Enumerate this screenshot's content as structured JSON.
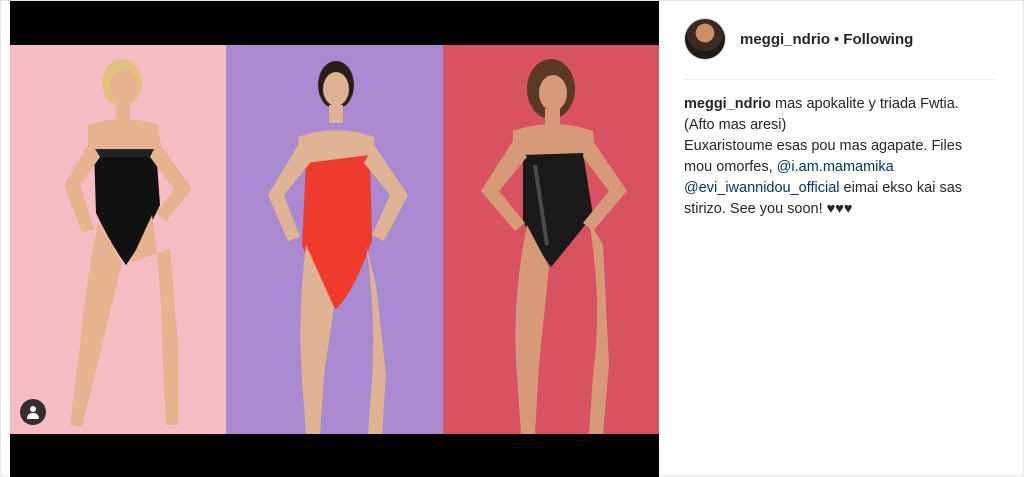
{
  "post": {
    "username": "meggi_ndrio",
    "separator": "•",
    "follow_status": "Following"
  },
  "caption": {
    "username": "meggi_ndrio",
    "line1": " mas apokalite y triada Fwtia.",
    "line2": "(Afto mas aresi)",
    "line3": "Euxaristoume esas pou mas agapate. Files mou omorfes, ",
    "mention1": "@i.am.mamamika",
    "mention2": "@evi_iwannidou_official",
    "line4": " eimai ekso kai sas stirizo. See you soon! ♥♥♥"
  },
  "media": {
    "panels": [
      {
        "background": "#f5bcc4",
        "swimsuit": "#111111",
        "hair": "#e2c27a"
      },
      {
        "background": "#a989cf",
        "swimsuit": "#ee3b2c",
        "hair": "#2a1e18"
      },
      {
        "background": "#d95261",
        "swimsuit": "#1a1a1a",
        "hair": "#5a3a24"
      }
    ]
  },
  "icons": {
    "user_tag": "user-tag-icon"
  },
  "colors": {
    "text": "#262626",
    "mention": "#003569",
    "divider": "#efefef",
    "media_border": "#000000"
  }
}
